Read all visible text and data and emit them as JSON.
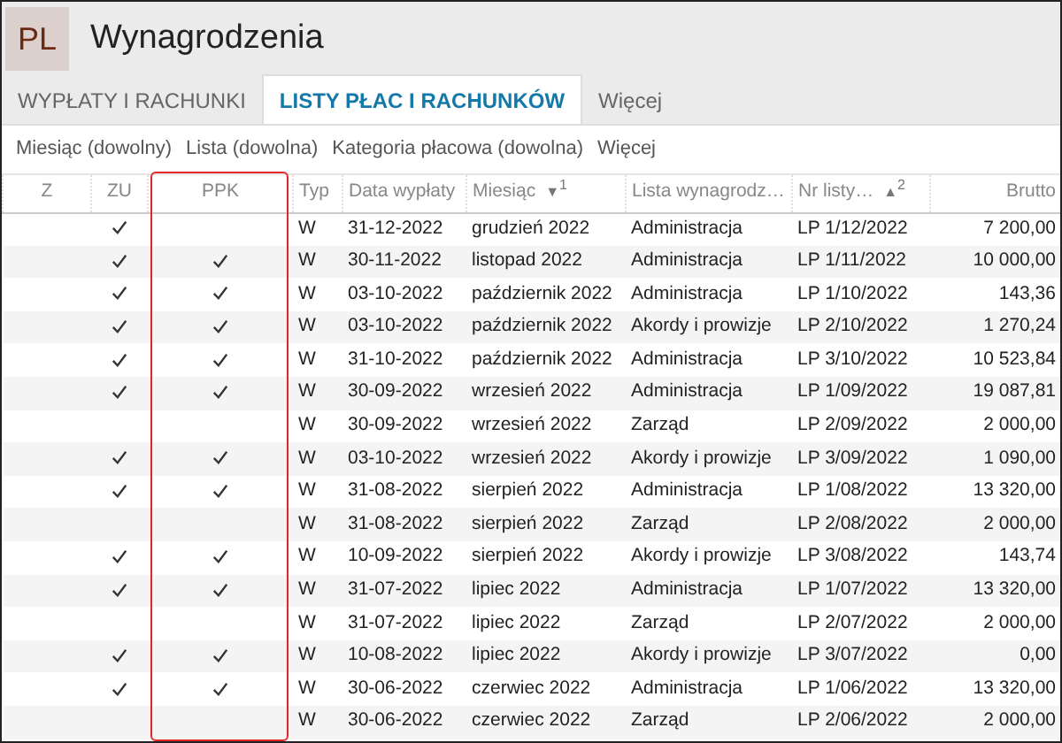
{
  "app": {
    "badge": "PL",
    "title": "Wynagrodzenia"
  },
  "tabs": [
    {
      "label": "WYPŁATY I RACHUNKI",
      "selected": false
    },
    {
      "label": "LISTY PŁAC I RACHUNKÓW",
      "selected": true
    },
    {
      "label": "Więcej",
      "selected": false
    }
  ],
  "filters": [
    "Miesiąc (dowolny)",
    "Lista (dowolna)",
    "Kategoria płacowa (dowolna)",
    "Więcej"
  ],
  "table": {
    "columns": [
      {
        "label": "Z"
      },
      {
        "label": "ZU"
      },
      {
        "label": "PPK"
      },
      {
        "label": "Typ"
      },
      {
        "label": "Data wypłaty"
      },
      {
        "label": "Miesiąc",
        "sort_mark": "▼",
        "sort_order": "1"
      },
      {
        "label": "Lista wynagrodz…"
      },
      {
        "label": "Nr listy…",
        "sort_mark": "▲",
        "sort_order": "2"
      },
      {
        "label": "Brutto"
      }
    ],
    "rows": [
      {
        "zu": true,
        "ppk": false,
        "typ": "W",
        "data": "31-12-2022",
        "miesiac": "grudzień 2022",
        "lista": "Administracja",
        "nr": "LP 1/12/2022",
        "brutto": "7 200,00"
      },
      {
        "zu": true,
        "ppk": true,
        "typ": "W",
        "data": "30-11-2022",
        "miesiac": "listopad 2022",
        "lista": "Administracja",
        "nr": "LP 1/11/2022",
        "brutto": "10 000,00"
      },
      {
        "zu": true,
        "ppk": true,
        "typ": "W",
        "data": "03-10-2022",
        "miesiac": "październik 2022",
        "lista": "Administracja",
        "nr": "LP 1/10/2022",
        "brutto": "143,36"
      },
      {
        "zu": true,
        "ppk": true,
        "typ": "W",
        "data": "03-10-2022",
        "miesiac": "październik 2022",
        "lista": "Akordy i prowizje",
        "nr": "LP 2/10/2022",
        "brutto": "1 270,24"
      },
      {
        "zu": true,
        "ppk": true,
        "typ": "W",
        "data": "31-10-2022",
        "miesiac": "październik 2022",
        "lista": "Administracja",
        "nr": "LP 3/10/2022",
        "brutto": "10 523,84"
      },
      {
        "zu": true,
        "ppk": true,
        "typ": "W",
        "data": "30-09-2022",
        "miesiac": "wrzesień 2022",
        "lista": "Administracja",
        "nr": "LP 1/09/2022",
        "brutto": "19 087,81"
      },
      {
        "zu": false,
        "ppk": false,
        "typ": "W",
        "data": "30-09-2022",
        "miesiac": "wrzesień 2022",
        "lista": "Zarząd",
        "nr": "LP 2/09/2022",
        "brutto": "2 000,00"
      },
      {
        "zu": true,
        "ppk": true,
        "typ": "W",
        "data": "03-10-2022",
        "miesiac": "wrzesień 2022",
        "lista": "Akordy i prowizje",
        "nr": "LP 3/09/2022",
        "brutto": "1 090,00"
      },
      {
        "zu": true,
        "ppk": true,
        "typ": "W",
        "data": "31-08-2022",
        "miesiac": "sierpień 2022",
        "lista": "Administracja",
        "nr": "LP 1/08/2022",
        "brutto": "13 320,00"
      },
      {
        "zu": false,
        "ppk": false,
        "typ": "W",
        "data": "31-08-2022",
        "miesiac": "sierpień 2022",
        "lista": "Zarząd",
        "nr": "LP 2/08/2022",
        "brutto": "2 000,00"
      },
      {
        "zu": true,
        "ppk": true,
        "typ": "W",
        "data": "10-09-2022",
        "miesiac": "sierpień 2022",
        "lista": "Akordy i prowizje",
        "nr": "LP 3/08/2022",
        "brutto": "143,74"
      },
      {
        "zu": true,
        "ppk": true,
        "typ": "W",
        "data": "31-07-2022",
        "miesiac": "lipiec 2022",
        "lista": "Administracja",
        "nr": "LP 1/07/2022",
        "brutto": "13 320,00"
      },
      {
        "zu": false,
        "ppk": false,
        "typ": "W",
        "data": "31-07-2022",
        "miesiac": "lipiec 2022",
        "lista": "Zarząd",
        "nr": "LP 2/07/2022",
        "brutto": "2 000,00"
      },
      {
        "zu": true,
        "ppk": true,
        "typ": "W",
        "data": "10-08-2022",
        "miesiac": "lipiec 2022",
        "lista": "Akordy i prowizje",
        "nr": "LP 3/07/2022",
        "brutto": "0,00"
      },
      {
        "zu": true,
        "ppk": true,
        "typ": "W",
        "data": "30-06-2022",
        "miesiac": "czerwiec 2022",
        "lista": "Administracja",
        "nr": "LP 1/06/2022",
        "brutto": "13 320,00"
      },
      {
        "zu": false,
        "ppk": false,
        "typ": "W",
        "data": "30-06-2022",
        "miesiac": "czerwiec 2022",
        "lista": "Zarząd",
        "nr": "LP 2/06/2022",
        "brutto": "2 000,00"
      }
    ]
  }
}
